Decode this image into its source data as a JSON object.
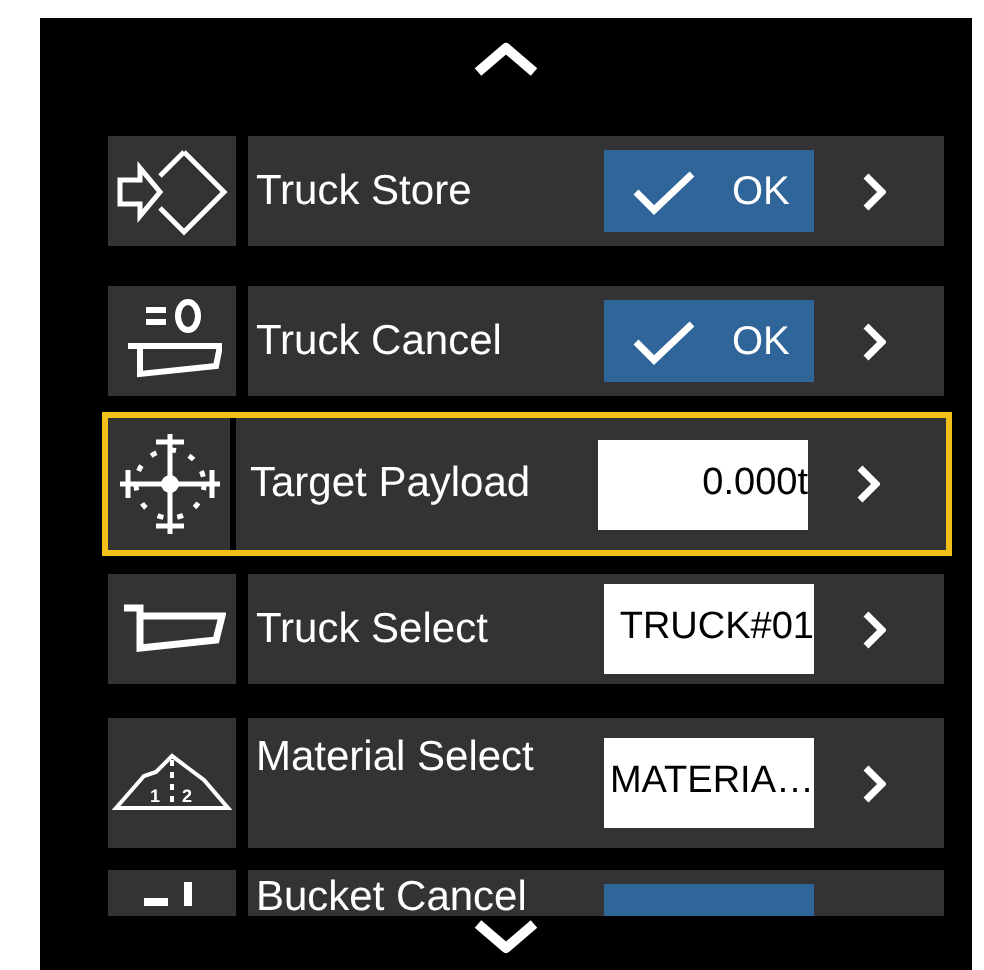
{
  "items": [
    {
      "label": "Truck Store",
      "kind": "ok",
      "value": "OK",
      "selected": false
    },
    {
      "label": "Truck Cancel",
      "kind": "ok",
      "value": "OK",
      "selected": false
    },
    {
      "label": "Target Payload",
      "kind": "value",
      "value": "0.000t",
      "selected": true
    },
    {
      "label": "Truck Select",
      "kind": "value",
      "value": "TRUCK#01",
      "selected": false
    },
    {
      "label": "Material Select",
      "kind": "list",
      "value": "MATERIA…",
      "icon_labels": [
        "1",
        "2"
      ],
      "selected": false
    },
    {
      "label": "Bucket Cancel",
      "kind": "ok",
      "selected": false
    }
  ]
}
